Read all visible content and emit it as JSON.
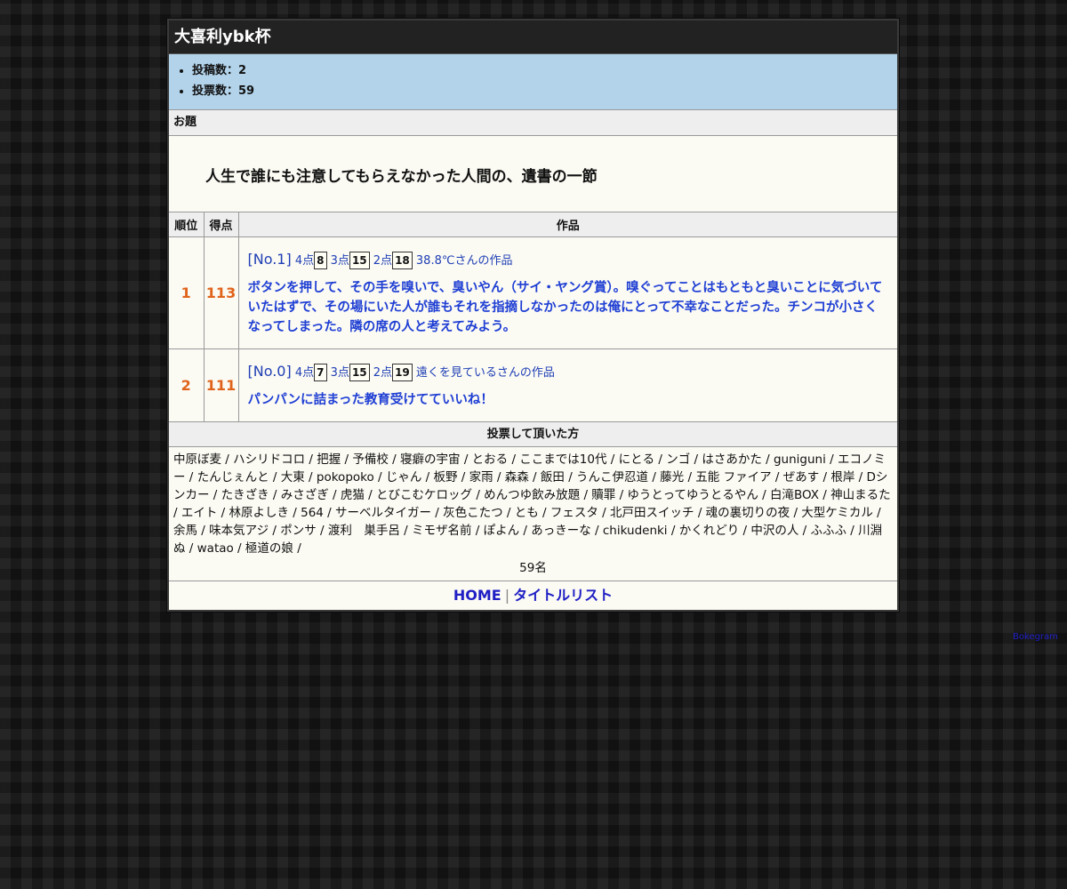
{
  "title": "大喜利ybk杯",
  "stats": {
    "posts": "投稿数：2",
    "votes": "投票数：59"
  },
  "odai": {
    "label": "お題",
    "text": "人生で誰にも注意してもらえなかった人間の、遺書の一節"
  },
  "table": {
    "headers": {
      "rank": "順位",
      "score": "得点",
      "work": "作品"
    },
    "rows": [
      {
        "rank": "1",
        "score": "113",
        "entry_no": "[No.1]",
        "p4_label": "4点",
        "p4": "8",
        "p3_label": "3点",
        "p3": "15",
        "p2_label": "2点",
        "p2": "18",
        "author": "38.8℃さんの作品",
        "text": "ボタンを押して、その手を嗅いで、臭いやん（サイ・ヤング賞）。嗅ぐってことはもともと臭いことに気づいていたはずで、その場にいた人が誰もそれを指摘しなかったのは俺にとって不幸なことだった。チンコが小さくなってしまった。隣の席の人と考えてみよう。"
      },
      {
        "rank": "2",
        "score": "111",
        "entry_no": "[No.0]",
        "p4_label": "4点",
        "p4": "7",
        "p3_label": "3点",
        "p3": "15",
        "p2_label": "2点",
        "p2": "19",
        "author": "遠くを見ているさんの作品",
        "text": "パンパンに詰まった教育受けてていいね！"
      }
    ]
  },
  "voters": {
    "label": "投票して頂いた方",
    "list": "中原ぼ麦 / ハシリドコロ / 把握 / 予備校 / 寝癖の宇宙 / とおる / ここまでは10代 / にとる / ンゴ / はさあかた / guniguni / エコノミー / たんじぇんと / 大東 / pokopoko / じゃん / 板野 / 家雨 / 森森 / 飯田 / うんこ伊忍道 / 藤光 / 五能 ファイア / ぜあす / 根岸 / Dシンカー / たきざき / みさざぎ / 虎猫 / とびこむケロッグ / めんつゆ飲み放題 / 贖罪 / ゆうとってゆうとるやん / 白滝BOX / 神山まるた / エイト / 林原よしき / 564 / サーベルタイガー / 灰色こたつ / とも / フェスタ / 北戸田スイッチ / 魂の裏切りの夜 / 大型ケミカル / 余馬 / 味本気アジ / ポンサ / 渡利　巣手呂 / ミモザ名前 / ぽよん / あっきーな / chikudenki / かくれどり / 中沢の人 / ふふふ / 川淵ぬ / watao / 極道の娘 /",
    "count": "59名"
  },
  "footer": {
    "home": "HOME",
    "sep": "|",
    "title_list": "タイトルリスト"
  },
  "credit": "Bokegram"
}
